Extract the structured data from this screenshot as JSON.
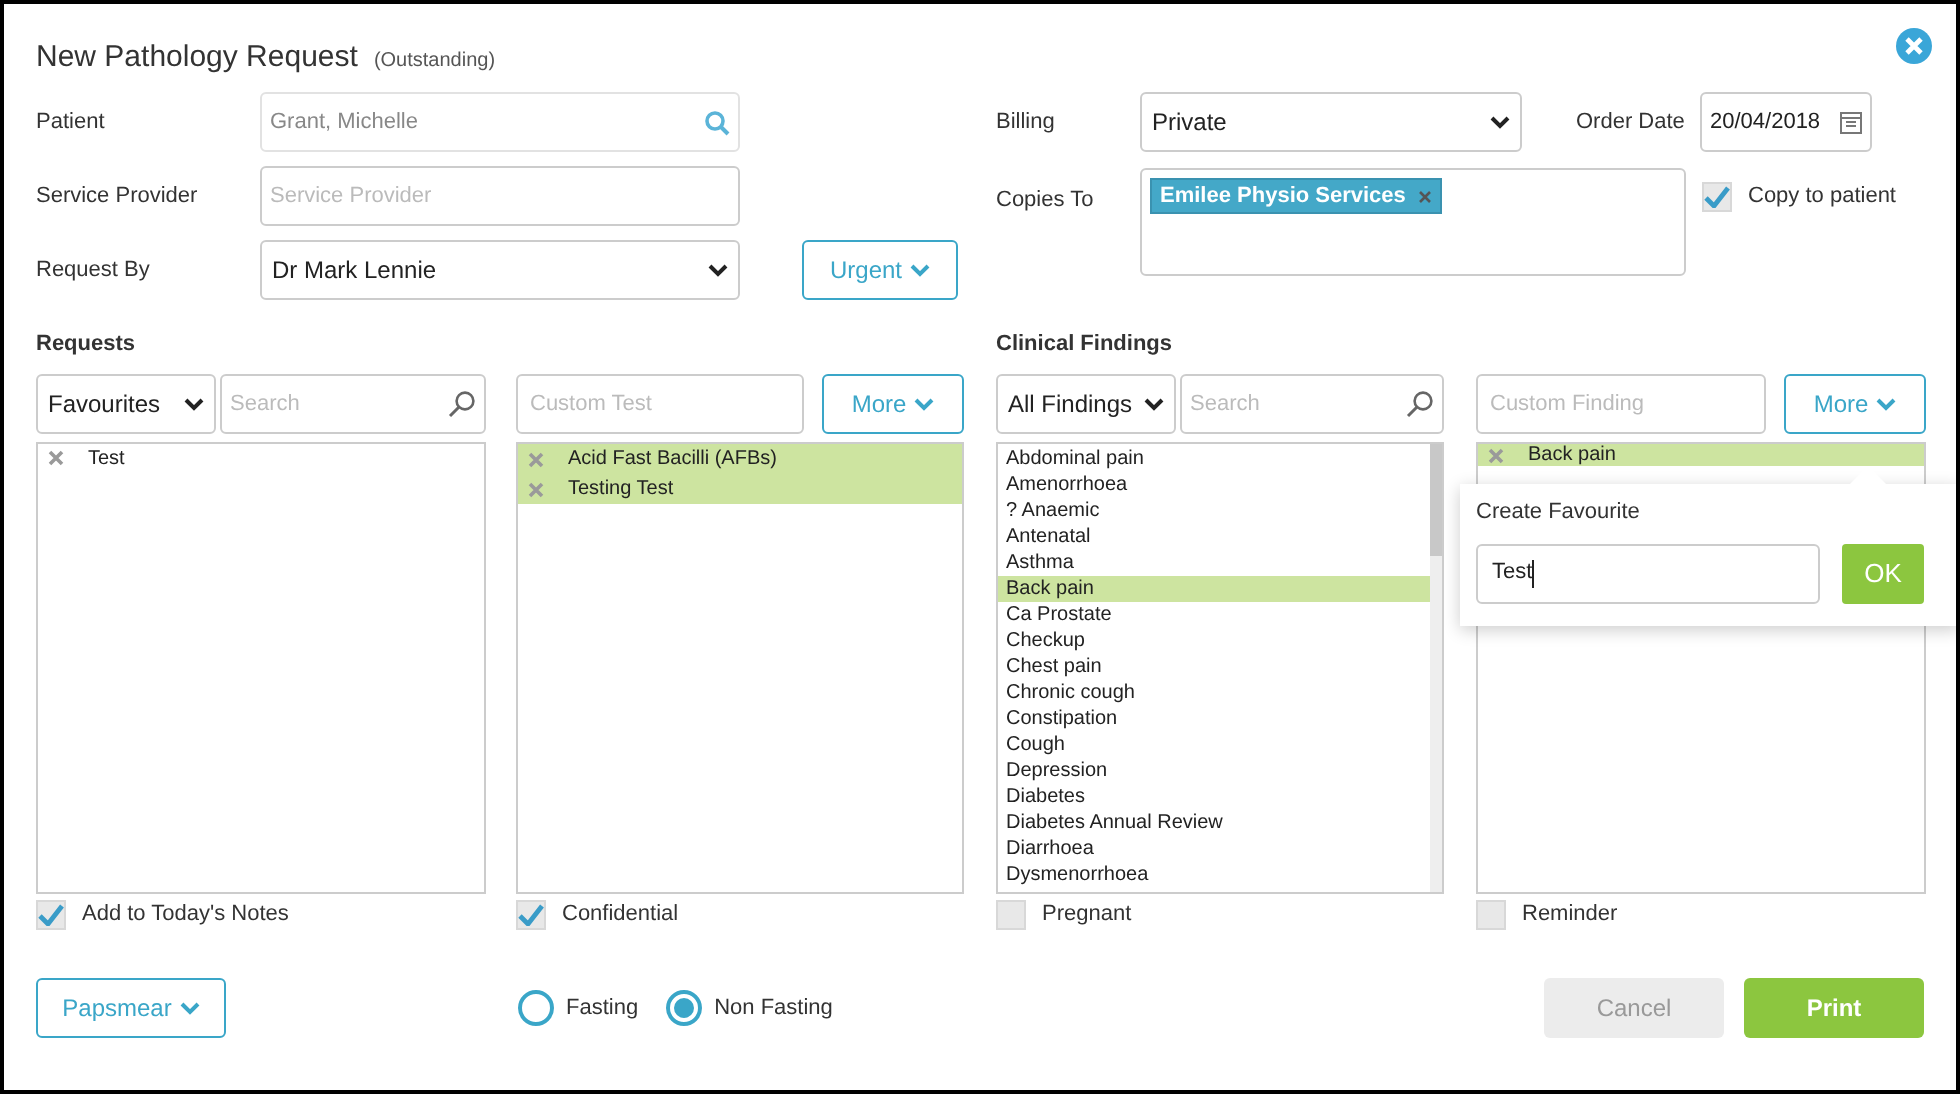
{
  "dialog": {
    "title": "New Pathology Request",
    "status": "(Outstanding)"
  },
  "form": {
    "patient": {
      "label": "Patient",
      "value": "Grant, Michelle"
    },
    "service_provider": {
      "label": "Service Provider",
      "placeholder": "Service Provider"
    },
    "request_by": {
      "label": "Request By",
      "value": "Dr Mark Lennie"
    },
    "urgent_button": "Urgent",
    "billing": {
      "label": "Billing",
      "value": "Private"
    },
    "order_date": {
      "label": "Order Date",
      "value": "20/04/2018"
    },
    "copies_to": {
      "label": "Copies To",
      "tags": [
        "Emilee Physio Services"
      ]
    },
    "copy_to_patient": {
      "label": "Copy to patient",
      "checked": true
    }
  },
  "requests": {
    "heading": "Requests",
    "filter": "Favourites",
    "search": {
      "placeholder": "Search"
    },
    "favourites": [
      "Test"
    ],
    "custom_test": {
      "placeholder": "Custom Test"
    },
    "more_button": "More",
    "selected_tests": [
      "Acid Fast Bacilli (AFBs)",
      "Testing Test"
    ],
    "add_to_notes": {
      "label": "Add to Today's Notes",
      "checked": true
    },
    "confidential": {
      "label": "Confidential",
      "checked": true
    }
  },
  "clinical_findings": {
    "heading": "Clinical Findings",
    "filter": "All Findings",
    "search": {
      "placeholder": "Search"
    },
    "findings": [
      {
        "label": "Abdominal pain",
        "selected": false
      },
      {
        "label": "Amenorrhoea",
        "selected": false
      },
      {
        "label": "? Anaemic",
        "selected": false
      },
      {
        "label": "Antenatal",
        "selected": false
      },
      {
        "label": "Asthma",
        "selected": false
      },
      {
        "label": "Back pain",
        "selected": true
      },
      {
        "label": "Ca Prostate",
        "selected": false
      },
      {
        "label": "Checkup",
        "selected": false
      },
      {
        "label": "Chest pain",
        "selected": false
      },
      {
        "label": "Chronic cough",
        "selected": false
      },
      {
        "label": "Constipation",
        "selected": false
      },
      {
        "label": "Cough",
        "selected": false
      },
      {
        "label": "Depression",
        "selected": false
      },
      {
        "label": "Diabetes",
        "selected": false
      },
      {
        "label": "Diabetes Annual Review",
        "selected": false
      },
      {
        "label": "Diarrhoea",
        "selected": false
      },
      {
        "label": "Dysmenorrhoea",
        "selected": false
      }
    ],
    "custom_finding": {
      "placeholder": "Custom Finding"
    },
    "more_button": "More",
    "selected_findings": [
      "Back pain"
    ],
    "pregnant": {
      "label": "Pregnant",
      "checked": false
    },
    "reminder": {
      "label": "Reminder",
      "checked": false
    }
  },
  "popover": {
    "title": "Create Favourite",
    "value": "Test",
    "ok_button": "OK"
  },
  "footer": {
    "papsmear_button": "Papsmear",
    "fasting": [
      {
        "label": "Fasting",
        "selected": false
      },
      {
        "label": "Non Fasting",
        "selected": true
      }
    ],
    "cancel_button": {
      "label": "Cancel",
      "disabled": true
    },
    "print_button": "Print"
  }
}
